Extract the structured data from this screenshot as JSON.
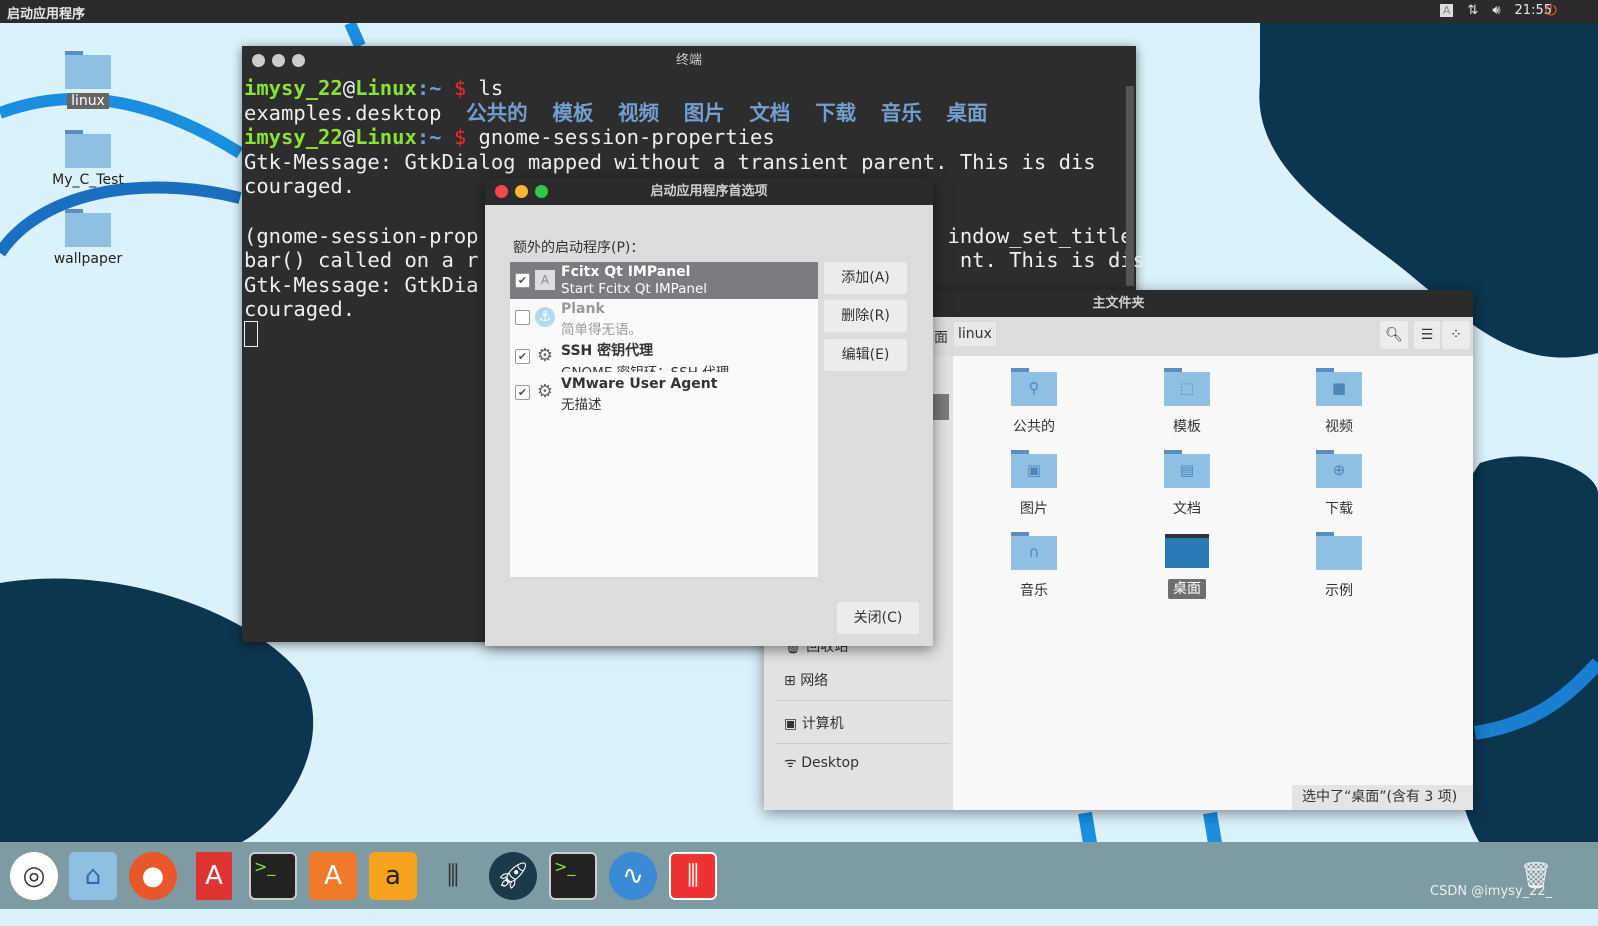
{
  "topbar": {
    "title": "启动应用程序",
    "input_indicator": "A",
    "time": "21:55"
  },
  "desktop": {
    "icons": [
      {
        "label": "linux"
      },
      {
        "label": "My_C_Test"
      },
      {
        "label": "wallpaper"
      }
    ]
  },
  "terminal": {
    "title": "终端",
    "prompt_user": "imysy_22",
    "prompt_host": "Linux",
    "prompt_path": ":~",
    "cmd1": "ls",
    "ls_file": "examples.desktop",
    "ls_dirs": "公共的  模板  视频  图片  文档  下载  音乐  桌面",
    "cmd2": "gnome-session-properties",
    "out1": "Gtk-Message: GtkDialog mapped without a transient parent. This is dis",
    "out2": "couraged.",
    "out3": "(gnome-session-prop                                      indow_set_title",
    "out4": "bar() called on a r",
    "out4b": "nt. This is dis",
    "out5": "Gtk-Message: GtkDia",
    "out6": "couraged."
  },
  "dialog": {
    "title": "启动应用程序首选项",
    "list_label": "额外的启动程序(P)：",
    "items": [
      {
        "name": "Fcitx Qt IMPanel",
        "desc": "Start Fcitx Qt IMPanel",
        "checked": true,
        "selected": true,
        "icon": "input-method-icon"
      },
      {
        "name": "Plank",
        "desc": "简单得无语。",
        "checked": false,
        "icon": "anchor-icon"
      },
      {
        "name": "SSH 密钥代理",
        "desc": "GNOME 密钥环：SSH 代理",
        "checked": true,
        "icon": "gears-icon"
      },
      {
        "name": "VMware User Agent",
        "desc": "无描述",
        "checked": true,
        "icon": "gears-icon"
      }
    ],
    "add": "添加(A)",
    "remove": "删除(R)",
    "edit": "编辑(E)",
    "close": "关闭(C)"
  },
  "files": {
    "title": "主文件夹",
    "path_prev": "面",
    "path_current": "linux",
    "sidebar": [
      {
        "label": "回收站"
      },
      {
        "label": "网络"
      },
      {
        "label": "计算机"
      },
      {
        "label": "Desktop"
      }
    ],
    "folders": [
      {
        "label": "公共的"
      },
      {
        "label": "模板"
      },
      {
        "label": "视频"
      },
      {
        "label": "图片"
      },
      {
        "label": "文档"
      },
      {
        "label": "下载"
      },
      {
        "label": "音乐"
      },
      {
        "label": "桌面",
        "selected": true
      },
      {
        "label": "示例"
      }
    ],
    "status": "选中了“桌面”(含有 3 项)"
  },
  "dock": {
    "apps": [
      "ubuntu",
      "home-folder",
      "firefox",
      "text-editor",
      "terminal",
      "software-center",
      "amazon",
      "mixer",
      "launcher",
      "terminal",
      "wave",
      "equalizer",
      "trash"
    ]
  },
  "watermark": "CSDN @imysy_22_"
}
